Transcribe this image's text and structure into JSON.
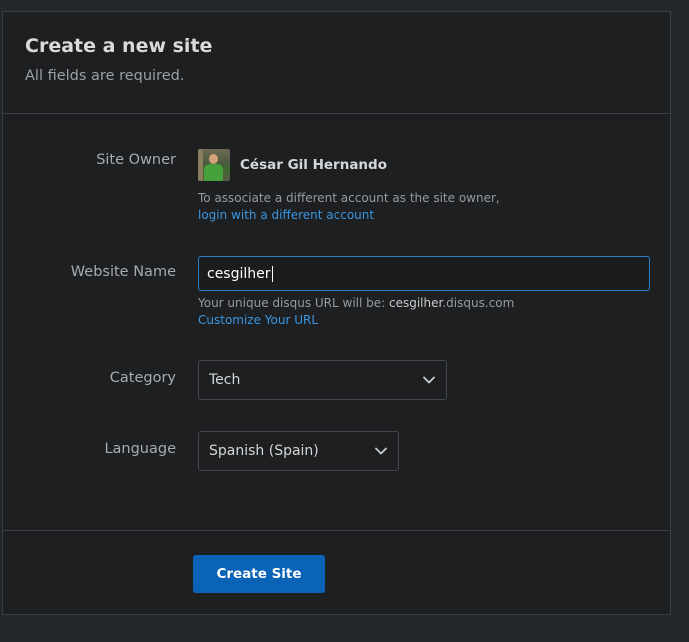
{
  "header": {
    "title": "Create a new site",
    "subtitle": "All fields are required."
  },
  "owner": {
    "label": "Site Owner",
    "name": "César Gil Hernando",
    "help": "To associate a different account as the site owner,",
    "link": "login with a different account"
  },
  "website": {
    "label": "Website Name",
    "value": "cesgilher",
    "url_prefix": "Your unique disqus URL will be: ",
    "url_slug": "cesgilher",
    "url_suffix": ".disqus.com",
    "customize_link": "Customize Your URL"
  },
  "category": {
    "label": "Category",
    "selected": "Tech"
  },
  "language": {
    "label": "Language",
    "selected": "Spanish (Spain)"
  },
  "footer": {
    "submit_label": "Create Site"
  },
  "colors": {
    "page_bg": "#24272a",
    "panel_bg": "#1d1f21",
    "accent": "#0b63b8",
    "link": "#3a96e0",
    "focus_border": "#2f7cc8"
  },
  "icons": {
    "select_arrow": "chevron-down-icon"
  }
}
